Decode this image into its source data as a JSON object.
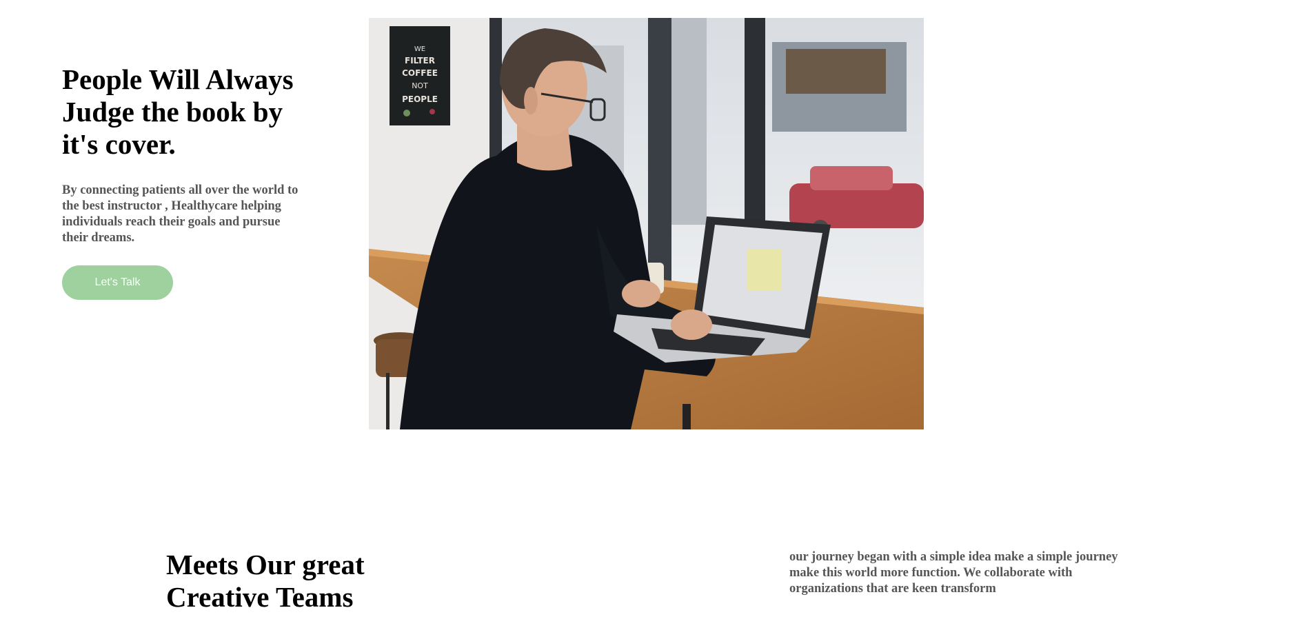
{
  "hero": {
    "title": "People Will Always Judge the book by it's cover.",
    "description": "By connecting patients all over the world to the best instructor , Healthycare helping individuals reach their goals and pursue their dreams.",
    "cta_label": "Let's Talk"
  },
  "poster": {
    "lines": [
      "WE",
      "FILTER",
      "COFFEE",
      "NOT",
      "PEOPLE"
    ]
  },
  "team": {
    "title": "Meets Our great Creative Teams",
    "description": "our journey began with a simple idea make a simple journey make this world more function. We collaborate with organizations that are keen transform"
  },
  "colors": {
    "accent": "#9fd19f",
    "heading": "#000000",
    "body_text": "#555555"
  }
}
